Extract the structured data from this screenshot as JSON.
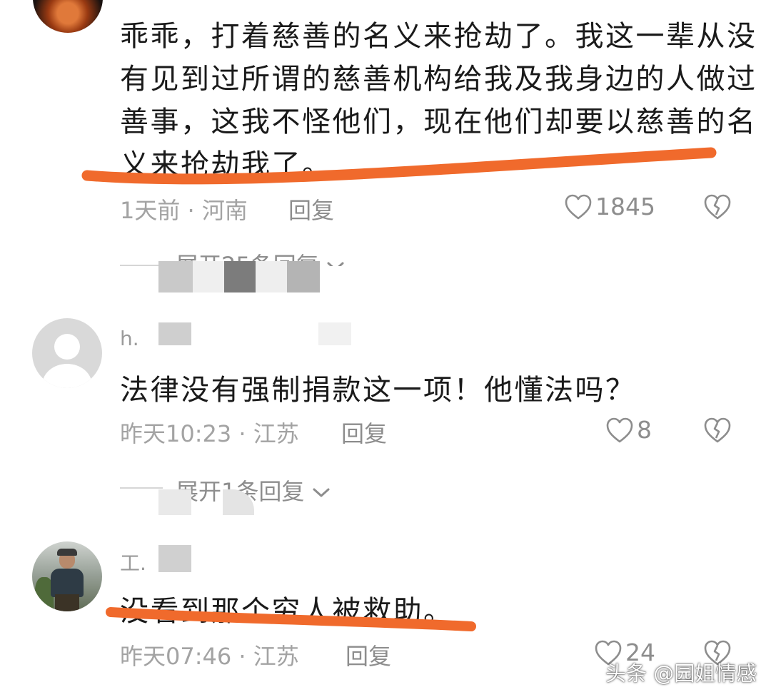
{
  "comments": [
    {
      "lines": [
        "乖乖，打着慈善的名义来抢劫了。我这一辈从没",
        "有见到过所谓的慈善机构给我及我身边的人做过",
        "善事，这我不怪他们，现在他们却要以慈善的名",
        "义来抢劫我了。"
      ],
      "meta": "1天前 · 河南",
      "reply_label": "回复",
      "like_count": "1845",
      "expand_label": "展开25条回复"
    },
    {
      "username": "h.",
      "text": "法律没有强制捐款这一项！他懂法吗？",
      "meta": "昨天10:23 · 江苏",
      "reply_label": "回复",
      "like_count": "8",
      "expand_label": "展开1条回复"
    },
    {
      "username": "工.",
      "text": "没看到那个穷人被救助。",
      "meta": "昨天07:46 · 江苏",
      "reply_label": "回复",
      "like_count": "24"
    }
  ],
  "watermark": "头条 @园姐情感",
  "colors": {
    "underline": "#f06a2c",
    "meta_text": "#a3a3a3",
    "body_text": "#1a1a1a"
  },
  "icons": [
    "heart-icon",
    "broken-heart-icon",
    "chevron-down-icon"
  ]
}
